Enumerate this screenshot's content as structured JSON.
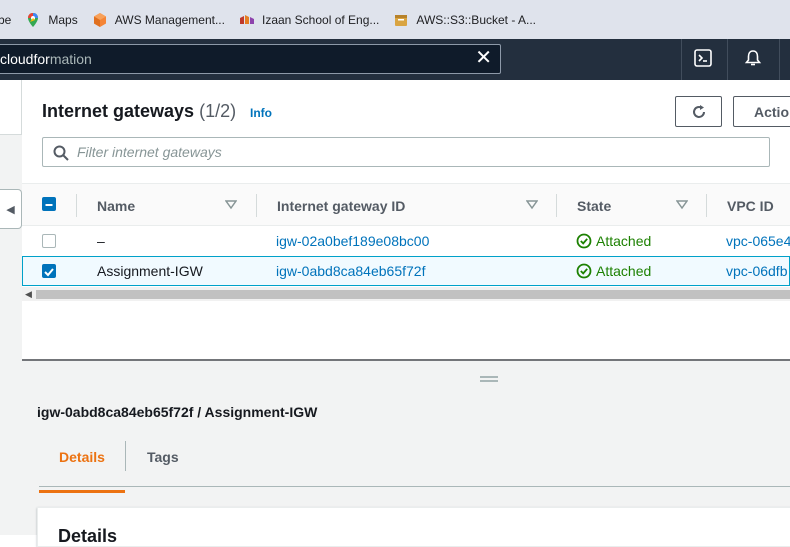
{
  "bookmarks": [
    {
      "label": "be",
      "icon": "youtube-icon"
    },
    {
      "label": "Maps",
      "icon": "maps-pin-icon"
    },
    {
      "label": "AWS Management...",
      "icon": "aws-cube-icon"
    },
    {
      "label": "Izaan School of Eng...",
      "icon": "school-logo-icon"
    },
    {
      "label": "AWS::S3::Bucket - A...",
      "icon": "aws-s3-icon"
    }
  ],
  "topnav": {
    "search_typed": "cloudfor",
    "search_suggest": "mation"
  },
  "table_header": {
    "title": "Internet gateways",
    "count": "(1/2)",
    "info": "Info",
    "actions_label": "Actio",
    "filter_placeholder": "Filter internet gateways"
  },
  "columns": [
    "Name",
    "Internet gateway ID",
    "State",
    "VPC ID"
  ],
  "rows": [
    {
      "name": "–",
      "igw_id": "igw-02a0bef189e08bc00",
      "state": "Attached",
      "vpc_id": "vpc-065e4",
      "selected": false
    },
    {
      "name": "Assignment-IGW",
      "igw_id": "igw-0abd8ca84eb65f72f",
      "state": "Attached",
      "vpc_id": "vpc-06dfb",
      "selected": true
    }
  ],
  "details": {
    "title": "igw-0abd8ca84eb65f72f / Assignment-IGW",
    "tabs": [
      "Details",
      "Tags"
    ],
    "active_tab": "Details",
    "section_heading": "Details"
  },
  "colors": {
    "topnav": "#232f3e",
    "link": "#0073bb",
    "success": "#1d8102",
    "active_tab": "#ec7211"
  }
}
